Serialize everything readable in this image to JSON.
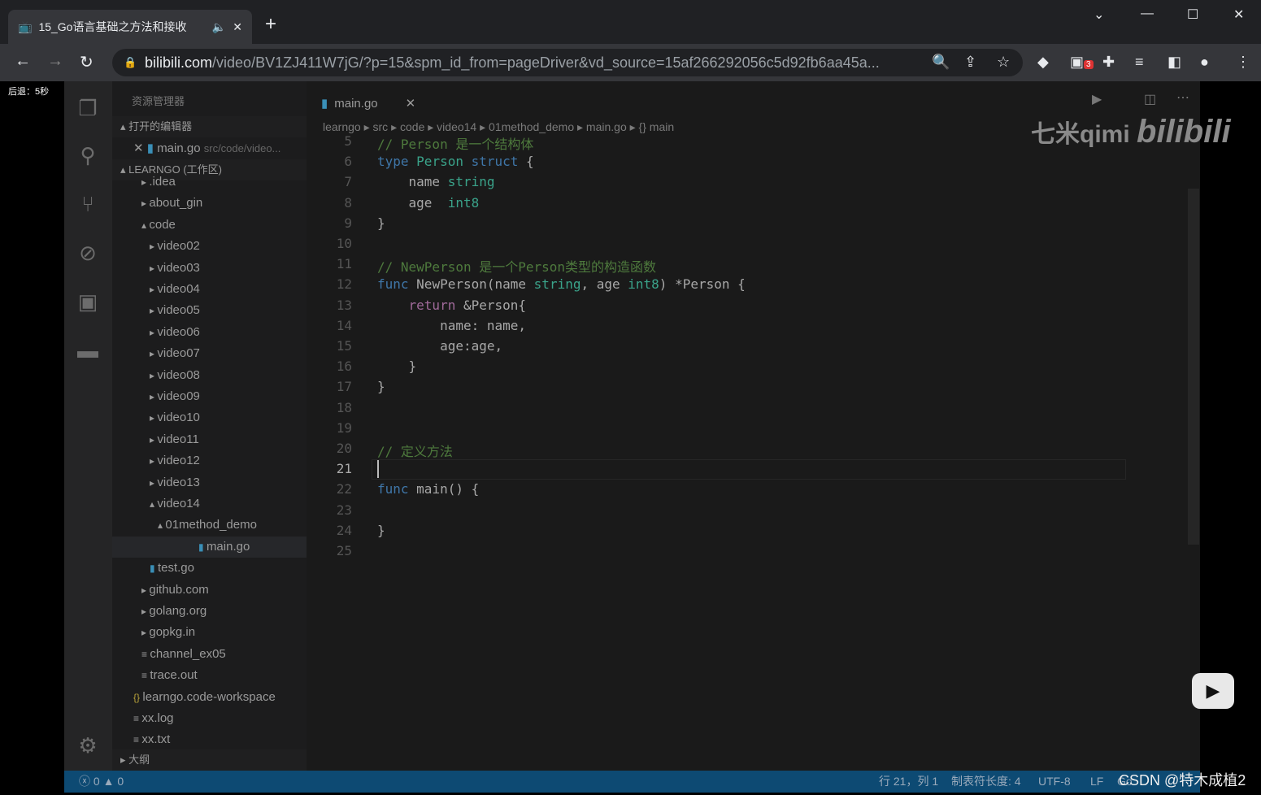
{
  "browser": {
    "tab_title": "15_Go语言基础之方法和接收",
    "url_host": "bilibili.com",
    "url_path": "/video/BV1ZJ411W7jG/?p=15&spm_id_from=pageDriver&vd_source=15af266292056c5d92fb6aa45a...",
    "ext_badge": "3"
  },
  "overlay": {
    "seek_hint": "后退：5秒",
    "watermark": "七米qimi bilibili",
    "csdn": "CSDN @特木成植2"
  },
  "explorer": {
    "title": "资源管理器",
    "open_editors": "打开的编辑器",
    "open_file": "main.go",
    "open_file_path": "src/code/video...",
    "workspace": "LEARNGO (工作区)",
    "outline": "大纲",
    "tree": [
      {
        "label": ".idea",
        "indent": 1,
        "type": "folder"
      },
      {
        "label": "about_gin",
        "indent": 1,
        "type": "folder"
      },
      {
        "label": "code",
        "indent": 1,
        "type": "folder-open"
      },
      {
        "label": "video02",
        "indent": 2,
        "type": "folder"
      },
      {
        "label": "video03",
        "indent": 2,
        "type": "folder"
      },
      {
        "label": "video04",
        "indent": 2,
        "type": "folder"
      },
      {
        "label": "video05",
        "indent": 2,
        "type": "folder"
      },
      {
        "label": "video06",
        "indent": 2,
        "type": "folder"
      },
      {
        "label": "video07",
        "indent": 2,
        "type": "folder"
      },
      {
        "label": "video08",
        "indent": 2,
        "type": "folder"
      },
      {
        "label": "video09",
        "indent": 2,
        "type": "folder"
      },
      {
        "label": "video10",
        "indent": 2,
        "type": "folder"
      },
      {
        "label": "video11",
        "indent": 2,
        "type": "folder"
      },
      {
        "label": "video12",
        "indent": 2,
        "type": "folder"
      },
      {
        "label": "video13",
        "indent": 2,
        "type": "folder"
      },
      {
        "label": "video14",
        "indent": 2,
        "type": "folder-open"
      },
      {
        "label": "01method_demo",
        "indent": 3,
        "type": "folder-open"
      },
      {
        "label": "main.go",
        "indent": 4,
        "type": "go",
        "selected": true
      },
      {
        "label": "test.go",
        "indent": 2,
        "type": "go"
      },
      {
        "label": "github.com",
        "indent": 1,
        "type": "folder"
      },
      {
        "label": "golang.org",
        "indent": 1,
        "type": "folder"
      },
      {
        "label": "gopkg.in",
        "indent": 1,
        "type": "folder"
      },
      {
        "label": "channel_ex05",
        "indent": 1,
        "type": "file"
      },
      {
        "label": "trace.out",
        "indent": 1,
        "type": "file"
      },
      {
        "label": "learngo.code-workspace",
        "indent": 0,
        "type": "json"
      },
      {
        "label": "xx.log",
        "indent": 0,
        "type": "file"
      },
      {
        "label": "xx.txt",
        "indent": 0,
        "type": "file"
      }
    ]
  },
  "editor": {
    "tab": "main.go",
    "breadcrumb": [
      "learngo",
      "src",
      "code",
      "video14",
      "01method_demo",
      "main.go",
      "{} main"
    ],
    "current_line": 21,
    "lines": [
      {
        "n": "5",
        "t": [
          [
            "// Person 是一个结构体",
            "c"
          ]
        ]
      },
      {
        "n": "6",
        "t": [
          [
            "type ",
            "k"
          ],
          [
            "Person ",
            "ty"
          ],
          [
            "struct",
            "k"
          ],
          [
            " {",
            ""
          ]
        ]
      },
      {
        "n": "7",
        "t": [
          [
            "    name ",
            ""
          ],
          [
            "string",
            "ty"
          ]
        ]
      },
      {
        "n": "8",
        "t": [
          [
            "    age  ",
            ""
          ],
          [
            "int8",
            "ty"
          ]
        ]
      },
      {
        "n": "9",
        "t": [
          [
            "}",
            ""
          ]
        ]
      },
      {
        "n": "10",
        "t": []
      },
      {
        "n": "11",
        "t": [
          [
            "// NewPerson 是一个Person类型的构造函数",
            "c"
          ]
        ]
      },
      {
        "n": "12",
        "t": [
          [
            "func ",
            "k"
          ],
          [
            "NewPerson(name ",
            ""
          ],
          [
            "string",
            "ty"
          ],
          [
            ", age ",
            ""
          ],
          [
            "int8",
            "ty"
          ],
          [
            ") *Person {",
            ""
          ]
        ]
      },
      {
        "n": "13",
        "t": [
          [
            "    ",
            ""
          ],
          [
            "return",
            "r"
          ],
          [
            " &Person{",
            ""
          ]
        ]
      },
      {
        "n": "14",
        "t": [
          [
            "        name: name,",
            ""
          ]
        ]
      },
      {
        "n": "15",
        "t": [
          [
            "        age:age,",
            ""
          ]
        ]
      },
      {
        "n": "16",
        "t": [
          [
            "    }",
            ""
          ]
        ]
      },
      {
        "n": "17",
        "t": [
          [
            "}",
            ""
          ]
        ]
      },
      {
        "n": "18",
        "t": []
      },
      {
        "n": "19",
        "t": []
      },
      {
        "n": "20",
        "t": [
          [
            "// 定义方法",
            "c"
          ]
        ]
      },
      {
        "n": "21",
        "t": []
      },
      {
        "n": "22",
        "t": [
          [
            "func ",
            "k"
          ],
          [
            "main() {",
            ""
          ]
        ]
      },
      {
        "n": "23",
        "t": []
      },
      {
        "n": "24",
        "t": [
          [
            "}",
            ""
          ]
        ]
      },
      {
        "n": "25",
        "t": []
      }
    ]
  },
  "status": {
    "errors": "0",
    "warnings": "0",
    "position": "行 21，列 1",
    "tab_size": "制表符长度: 4",
    "encoding": "UTF-8",
    "eol": "LF",
    "lang": "Go"
  }
}
